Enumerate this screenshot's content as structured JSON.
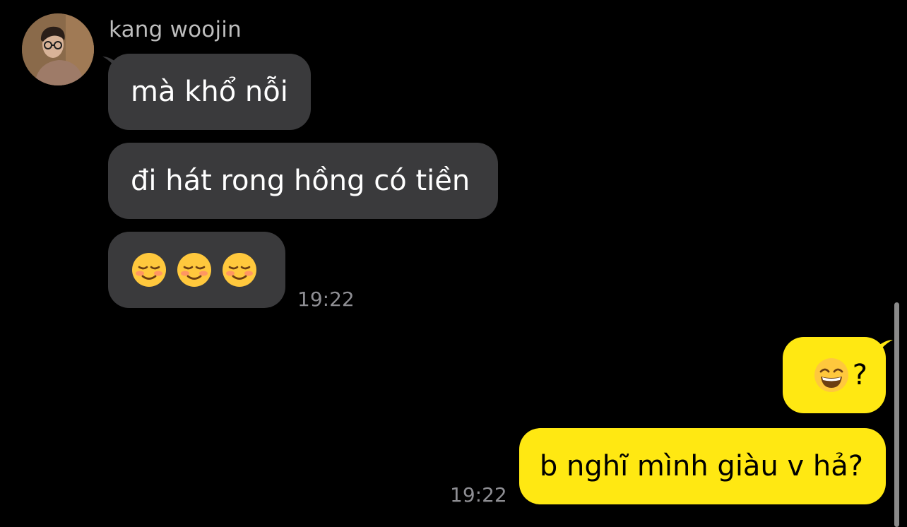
{
  "conversation": {
    "sender_name": "kang woojin",
    "incoming": [
      {
        "text": "mà khổ nỗi"
      },
      {
        "text": "đi hát rong hồng có tiền"
      },
      {
        "emojis": [
          "smiling-face-emoji",
          "smiling-face-emoji",
          "smiling-face-emoji"
        ]
      }
    ],
    "incoming_time": "19:22",
    "outgoing": [
      {
        "text": "?",
        "emoji": "grinning-face-with-smiling-eyes-emoji"
      },
      {
        "text": "b nghĩ mình giàu v hả?"
      }
    ],
    "outgoing_time": "19:22"
  },
  "colors": {
    "background": "#000000",
    "incoming_bubble": "#3a3a3c",
    "outgoing_bubble": "#ffe812",
    "sender_name": "#bdbdbd",
    "timestamp": "#8e8e93"
  }
}
